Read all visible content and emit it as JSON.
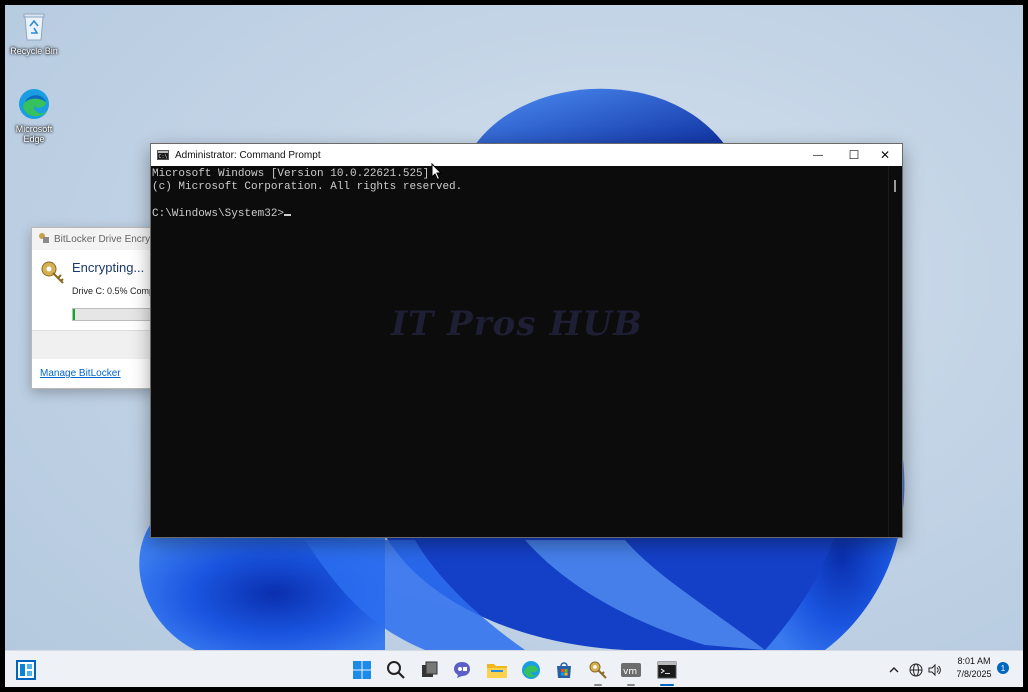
{
  "desktop": {
    "icons": [
      {
        "label": "Recycle Bin",
        "icon": "recycle-bin-icon"
      },
      {
        "label": "Microsoft Edge",
        "icon": "edge-icon"
      }
    ]
  },
  "bitlocker": {
    "title": "BitLocker Drive Encryptio",
    "heading": "Encrypting...",
    "status": "Drive C: 0.5% Comp",
    "progress_percent": 0.5,
    "link": "Manage BitLocker"
  },
  "cmd": {
    "title": "Administrator: Command Prompt",
    "lines": [
      "Microsoft Windows [Version 10.0.22621.525]",
      "(c) Microsoft Corporation. All rights reserved.",
      "",
      "C:\\Windows\\System32>"
    ],
    "controls": {
      "minimize": "—",
      "maximize": "☐",
      "close": "✕"
    }
  },
  "watermark": "IT Pros HUB",
  "taskbar": {
    "items": [
      "widgets-icon",
      "start-icon",
      "search-icon",
      "task-view-icon",
      "chat-icon",
      "file-explorer-icon",
      "edge-icon",
      "store-icon",
      "bitlocker-icon",
      "vmware-icon",
      "terminal-icon"
    ],
    "tray": {
      "time": "8:01 AM",
      "date": "7/8/2025",
      "notifications": "1"
    }
  },
  "colors": {
    "accent": "#0067c0",
    "console_bg": "#0c0c0c",
    "console_fg": "#cccccc",
    "progress": "#06b025"
  }
}
